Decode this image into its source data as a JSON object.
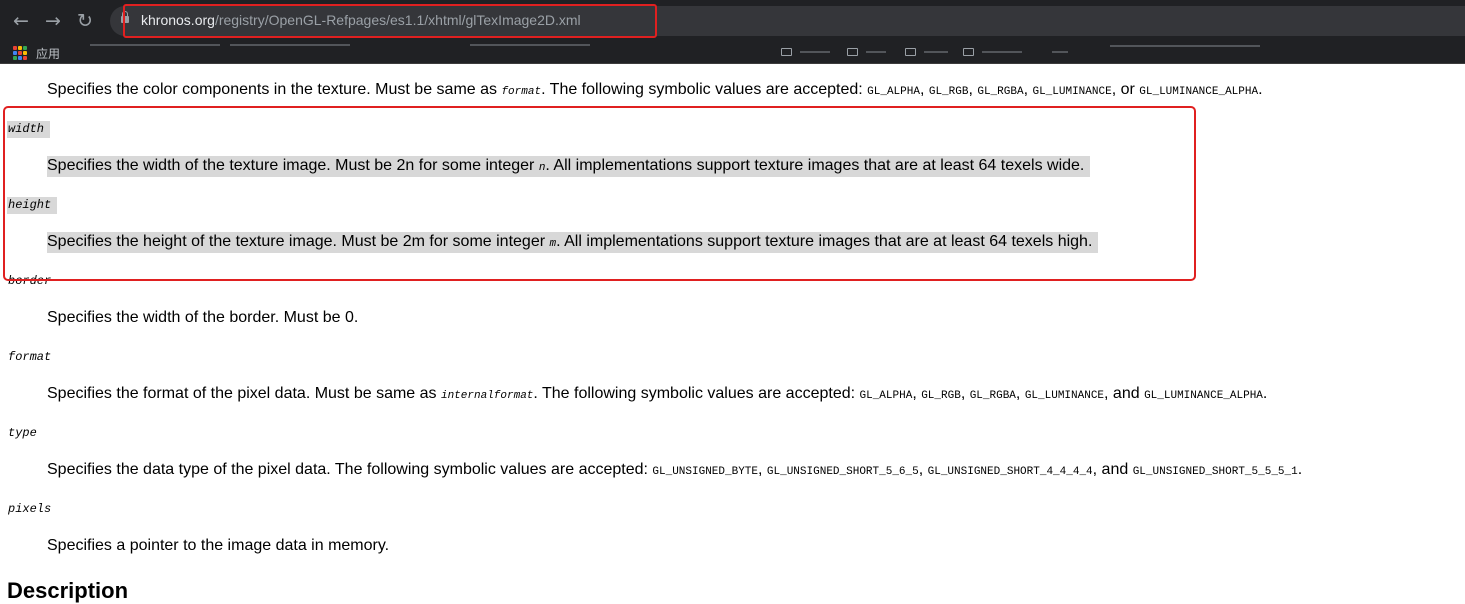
{
  "browser": {
    "url_host": "khronos.org",
    "url_path": "/registry/OpenGL-Refpages/es1.1/xhtml/glTexImage2D.xml",
    "apps_label": "应用",
    "back_icon": "back-arrow-icon",
    "forward_icon": "forward-arrow-icon",
    "reload_icon": "reload-icon",
    "lock_icon": "lock-icon",
    "highlight_color": "#e02020"
  },
  "params": {
    "internalformat": {
      "prefix": "Specifies the color components in the texture. Must be same as ",
      "ref": "format",
      "mid": ". The following symbolic values are accepted: ",
      "values": [
        "GL_ALPHA",
        "GL_RGB",
        "GL_RGBA",
        "GL_LUMINANCE",
        "GL_LUMINANCE_ALPHA"
      ],
      "conj": "or"
    },
    "width": {
      "name": "width",
      "before": "Specifies the width of the texture image. Must be 2n for some integer ",
      "var": "n",
      "after": ". All implementations support texture images that are at least 64 texels wide."
    },
    "height": {
      "name": "height",
      "before": "Specifies the height of the texture image. Must be 2m for some integer ",
      "var": "m",
      "after": ". All implementations support texture images that are at least 64 texels high."
    },
    "border": {
      "name": "border",
      "desc": "Specifies the width of the border. Must be 0."
    },
    "format": {
      "name": "format",
      "prefix": "Specifies the format of the pixel data. Must be same as ",
      "ref": "internalformat",
      "mid": ". The following symbolic values are accepted: ",
      "values": [
        "GL_ALPHA",
        "GL_RGB",
        "GL_RGBA",
        "GL_LUMINANCE",
        "GL_LUMINANCE_ALPHA"
      ],
      "conj": "and"
    },
    "type": {
      "name": "type",
      "prefix": "Specifies the data type of the pixel data. The following symbolic values are accepted: ",
      "values": [
        "GL_UNSIGNED_BYTE",
        "GL_UNSIGNED_SHORT_5_6_5",
        "GL_UNSIGNED_SHORT_4_4_4_4",
        "GL_UNSIGNED_SHORT_5_5_5_1"
      ],
      "conj": "and"
    },
    "pixels": {
      "name": "pixels",
      "desc": "Specifies a pointer to the image data in memory."
    }
  },
  "section_title": "Description",
  "selection_color": "#d8d8d8"
}
